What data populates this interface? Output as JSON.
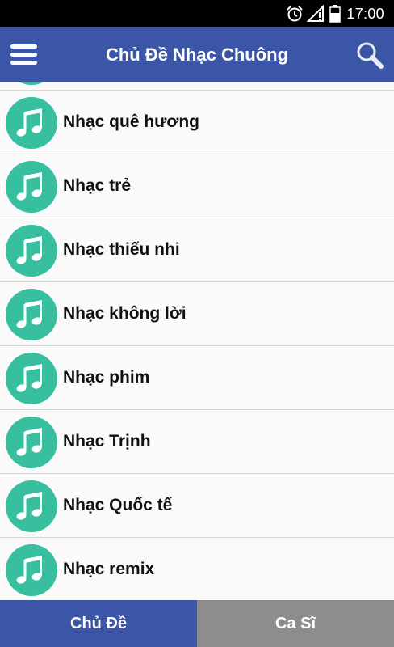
{
  "status_bar": {
    "time": "17:00",
    "icons": [
      "alarm-icon",
      "signal-icon",
      "battery-icon"
    ]
  },
  "app_bar": {
    "title": "Chủ Đề Nhạc Chuông",
    "menu_icon": "hamburger-menu-icon",
    "search_icon": "search-icon"
  },
  "list": {
    "items": [
      {
        "label": "Nhạc quê hương",
        "icon": "music-note-icon"
      },
      {
        "label": "Nhạc trẻ",
        "icon": "music-note-icon"
      },
      {
        "label": "Nhạc thiếu nhi",
        "icon": "music-note-icon"
      },
      {
        "label": "Nhạc không lời",
        "icon": "music-note-icon"
      },
      {
        "label": "Nhạc phim",
        "icon": "music-note-icon"
      },
      {
        "label": "Nhạc Trịnh",
        "icon": "music-note-icon"
      },
      {
        "label": "Nhạc Quốc tế",
        "icon": "music-note-icon"
      },
      {
        "label": "Nhạc remix",
        "icon": "music-note-icon"
      }
    ]
  },
  "tabs": {
    "active": "Chủ Đề",
    "inactive": "Ca Sĩ"
  },
  "colors": {
    "primary": "#3b56a6",
    "icon_circle": "#37bfa0",
    "inactive_tab": "#8d8d8d"
  }
}
